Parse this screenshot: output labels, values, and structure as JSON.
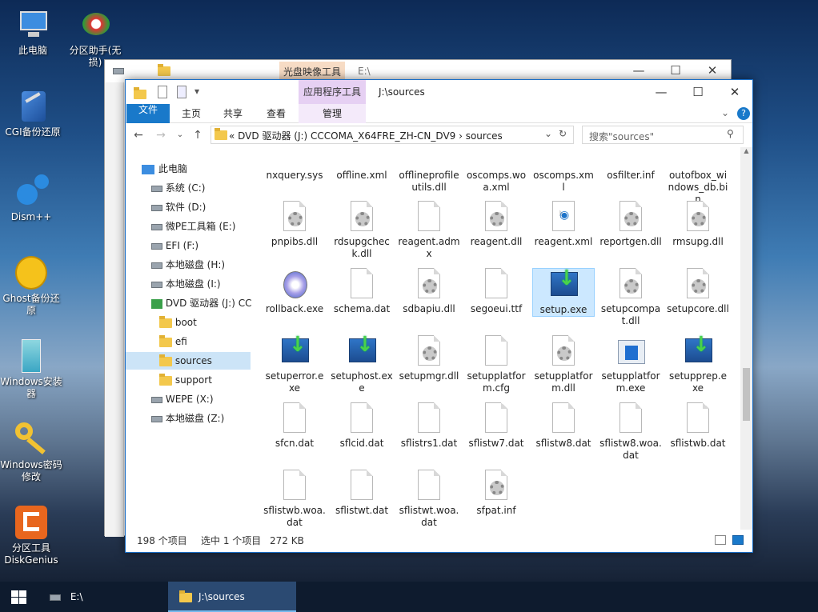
{
  "desktop": {
    "icons": [
      {
        "label": "此电脑"
      },
      {
        "label": "分区助手(无损)"
      },
      {
        "label": "CGI备份还原"
      },
      {
        "label": "Dism++"
      },
      {
        "label": "Ghost备份还原"
      },
      {
        "label": "Windows安装器"
      },
      {
        "label": "Windows密码修改"
      },
      {
        "label": "分区工具DiskGenius"
      }
    ]
  },
  "bg_window": {
    "ctx_tab": "光盘映像工具",
    "path": "E:\\"
  },
  "window": {
    "ctx_tab": "应用程序工具",
    "path": "J:\\sources",
    "ribbon_tabs": [
      "文件",
      "主页",
      "共享",
      "查看",
      "管理"
    ],
    "address": "« DVD 驱动器 (J:) CCCOMA_X64FRE_ZH-CN_DV9  ›  sources",
    "search_placeholder": "搜索\"sources\"",
    "tree": [
      {
        "label": "此电脑"
      },
      {
        "label": "系统 (C:)"
      },
      {
        "label": "软件 (D:)"
      },
      {
        "label": "微PE工具箱 (E:)"
      },
      {
        "label": "EFI (F:)"
      },
      {
        "label": "本地磁盘 (H:)"
      },
      {
        "label": "本地磁盘 (I:)"
      },
      {
        "label": "DVD 驱动器 (J:) CC"
      },
      {
        "label": "boot"
      },
      {
        "label": "efi"
      },
      {
        "label": "sources"
      },
      {
        "label": "support"
      },
      {
        "label": "WEPE (X:)"
      },
      {
        "label": "本地磁盘 (Z:)"
      }
    ],
    "files": [
      {
        "name": "nxquery.sys",
        "icon": "gear"
      },
      {
        "name": "offline.xml",
        "icon": "doc"
      },
      {
        "name": "offlineprofileutils.dll",
        "icon": "gear"
      },
      {
        "name": "oscomps.woa.xml",
        "icon": "doc"
      },
      {
        "name": "oscomps.xml",
        "icon": "doc"
      },
      {
        "name": "osfilter.inf",
        "icon": "gear"
      },
      {
        "name": "outofbox_windows_db.bin",
        "icon": "doc"
      },
      {
        "name": "pnpibs.dll",
        "icon": "gear"
      },
      {
        "name": "rdsupgcheck.dll",
        "icon": "gear"
      },
      {
        "name": "reagent.admx",
        "icon": "doc"
      },
      {
        "name": "reagent.dll",
        "icon": "gear"
      },
      {
        "name": "reagent.xml",
        "icon": "html"
      },
      {
        "name": "reportgen.dll",
        "icon": "gear"
      },
      {
        "name": "rmsupg.dll",
        "icon": "gear"
      },
      {
        "name": "rollback.exe",
        "icon": "rollback"
      },
      {
        "name": "schema.dat",
        "icon": "doc"
      },
      {
        "name": "sdbapiu.dll",
        "icon": "gear"
      },
      {
        "name": "segoeui.ttf",
        "icon": "doc"
      },
      {
        "name": "setup.exe",
        "icon": "setup"
      },
      {
        "name": "setupcompat.dll",
        "icon": "gear"
      },
      {
        "name": "setupcore.dll",
        "icon": "gear"
      },
      {
        "name": "setuperror.exe",
        "icon": "setup"
      },
      {
        "name": "setuphost.exe",
        "icon": "setup"
      },
      {
        "name": "setupmgr.dll",
        "icon": "gear"
      },
      {
        "name": "setupplatform.cfg",
        "icon": "doc"
      },
      {
        "name": "setupplatform.dll",
        "icon": "gear"
      },
      {
        "name": "setupplatform.exe",
        "icon": "winapp"
      },
      {
        "name": "setupprep.exe",
        "icon": "setup"
      },
      {
        "name": "sfcn.dat",
        "icon": "doc"
      },
      {
        "name": "sflcid.dat",
        "icon": "doc"
      },
      {
        "name": "sflistrs1.dat",
        "icon": "doc"
      },
      {
        "name": "sflistw7.dat",
        "icon": "doc"
      },
      {
        "name": "sflistw8.dat",
        "icon": "doc"
      },
      {
        "name": "sflistw8.woa.dat",
        "icon": "doc"
      },
      {
        "name": "sflistwb.dat",
        "icon": "doc"
      },
      {
        "name": "sflistwb.woa.dat",
        "icon": "doc"
      },
      {
        "name": "sflistwt.dat",
        "icon": "doc"
      },
      {
        "name": "sflistwt.woa.dat",
        "icon": "doc"
      },
      {
        "name": "sfpat.inf",
        "icon": "gear"
      }
    ],
    "selected_file": "setup.exe",
    "status_count": "198 个项目",
    "status_selected": "选中 1 个项目",
    "status_size": "272 KB"
  },
  "taskbar": {
    "drive_label": "E:\\",
    "active_label": "J:\\sources"
  }
}
